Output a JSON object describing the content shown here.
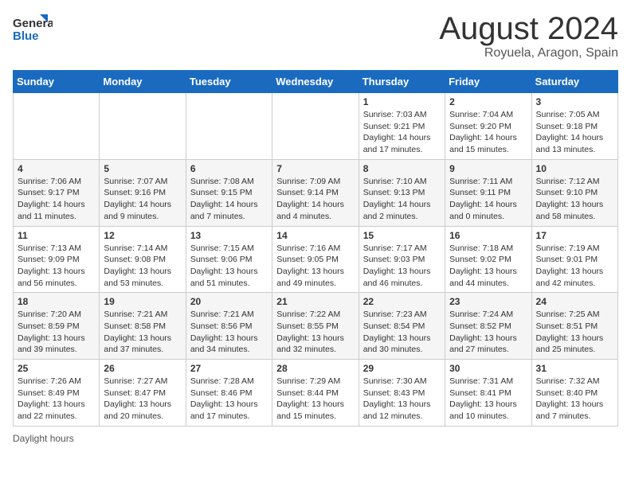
{
  "header": {
    "logo_general": "General",
    "logo_blue": "Blue",
    "month": "August 2024",
    "location": "Royuela, Aragon, Spain"
  },
  "days_of_week": [
    "Sunday",
    "Monday",
    "Tuesday",
    "Wednesday",
    "Thursday",
    "Friday",
    "Saturday"
  ],
  "weeks": [
    [
      {
        "day": "",
        "info": ""
      },
      {
        "day": "",
        "info": ""
      },
      {
        "day": "",
        "info": ""
      },
      {
        "day": "",
        "info": ""
      },
      {
        "day": "1",
        "info": "Sunrise: 7:03 AM\nSunset: 9:21 PM\nDaylight: 14 hours\nand 17 minutes."
      },
      {
        "day": "2",
        "info": "Sunrise: 7:04 AM\nSunset: 9:20 PM\nDaylight: 14 hours\nand 15 minutes."
      },
      {
        "day": "3",
        "info": "Sunrise: 7:05 AM\nSunset: 9:18 PM\nDaylight: 14 hours\nand 13 minutes."
      }
    ],
    [
      {
        "day": "4",
        "info": "Sunrise: 7:06 AM\nSunset: 9:17 PM\nDaylight: 14 hours\nand 11 minutes."
      },
      {
        "day": "5",
        "info": "Sunrise: 7:07 AM\nSunset: 9:16 PM\nDaylight: 14 hours\nand 9 minutes."
      },
      {
        "day": "6",
        "info": "Sunrise: 7:08 AM\nSunset: 9:15 PM\nDaylight: 14 hours\nand 7 minutes."
      },
      {
        "day": "7",
        "info": "Sunrise: 7:09 AM\nSunset: 9:14 PM\nDaylight: 14 hours\nand 4 minutes."
      },
      {
        "day": "8",
        "info": "Sunrise: 7:10 AM\nSunset: 9:13 PM\nDaylight: 14 hours\nand 2 minutes."
      },
      {
        "day": "9",
        "info": "Sunrise: 7:11 AM\nSunset: 9:11 PM\nDaylight: 14 hours\nand 0 minutes."
      },
      {
        "day": "10",
        "info": "Sunrise: 7:12 AM\nSunset: 9:10 PM\nDaylight: 13 hours\nand 58 minutes."
      }
    ],
    [
      {
        "day": "11",
        "info": "Sunrise: 7:13 AM\nSunset: 9:09 PM\nDaylight: 13 hours\nand 56 minutes."
      },
      {
        "day": "12",
        "info": "Sunrise: 7:14 AM\nSunset: 9:08 PM\nDaylight: 13 hours\nand 53 minutes."
      },
      {
        "day": "13",
        "info": "Sunrise: 7:15 AM\nSunset: 9:06 PM\nDaylight: 13 hours\nand 51 minutes."
      },
      {
        "day": "14",
        "info": "Sunrise: 7:16 AM\nSunset: 9:05 PM\nDaylight: 13 hours\nand 49 minutes."
      },
      {
        "day": "15",
        "info": "Sunrise: 7:17 AM\nSunset: 9:03 PM\nDaylight: 13 hours\nand 46 minutes."
      },
      {
        "day": "16",
        "info": "Sunrise: 7:18 AM\nSunset: 9:02 PM\nDaylight: 13 hours\nand 44 minutes."
      },
      {
        "day": "17",
        "info": "Sunrise: 7:19 AM\nSunset: 9:01 PM\nDaylight: 13 hours\nand 42 minutes."
      }
    ],
    [
      {
        "day": "18",
        "info": "Sunrise: 7:20 AM\nSunset: 8:59 PM\nDaylight: 13 hours\nand 39 minutes."
      },
      {
        "day": "19",
        "info": "Sunrise: 7:21 AM\nSunset: 8:58 PM\nDaylight: 13 hours\nand 37 minutes."
      },
      {
        "day": "20",
        "info": "Sunrise: 7:21 AM\nSunset: 8:56 PM\nDaylight: 13 hours\nand 34 minutes."
      },
      {
        "day": "21",
        "info": "Sunrise: 7:22 AM\nSunset: 8:55 PM\nDaylight: 13 hours\nand 32 minutes."
      },
      {
        "day": "22",
        "info": "Sunrise: 7:23 AM\nSunset: 8:54 PM\nDaylight: 13 hours\nand 30 minutes."
      },
      {
        "day": "23",
        "info": "Sunrise: 7:24 AM\nSunset: 8:52 PM\nDaylight: 13 hours\nand 27 minutes."
      },
      {
        "day": "24",
        "info": "Sunrise: 7:25 AM\nSunset: 8:51 PM\nDaylight: 13 hours\nand 25 minutes."
      }
    ],
    [
      {
        "day": "25",
        "info": "Sunrise: 7:26 AM\nSunset: 8:49 PM\nDaylight: 13 hours\nand 22 minutes."
      },
      {
        "day": "26",
        "info": "Sunrise: 7:27 AM\nSunset: 8:47 PM\nDaylight: 13 hours\nand 20 minutes."
      },
      {
        "day": "27",
        "info": "Sunrise: 7:28 AM\nSunset: 8:46 PM\nDaylight: 13 hours\nand 17 minutes."
      },
      {
        "day": "28",
        "info": "Sunrise: 7:29 AM\nSunset: 8:44 PM\nDaylight: 13 hours\nand 15 minutes."
      },
      {
        "day": "29",
        "info": "Sunrise: 7:30 AM\nSunset: 8:43 PM\nDaylight: 13 hours\nand 12 minutes."
      },
      {
        "day": "30",
        "info": "Sunrise: 7:31 AM\nSunset: 8:41 PM\nDaylight: 13 hours\nand 10 minutes."
      },
      {
        "day": "31",
        "info": "Sunrise: 7:32 AM\nSunset: 8:40 PM\nDaylight: 13 hours\nand 7 minutes."
      }
    ]
  ],
  "footer": {
    "note": "Daylight hours"
  }
}
